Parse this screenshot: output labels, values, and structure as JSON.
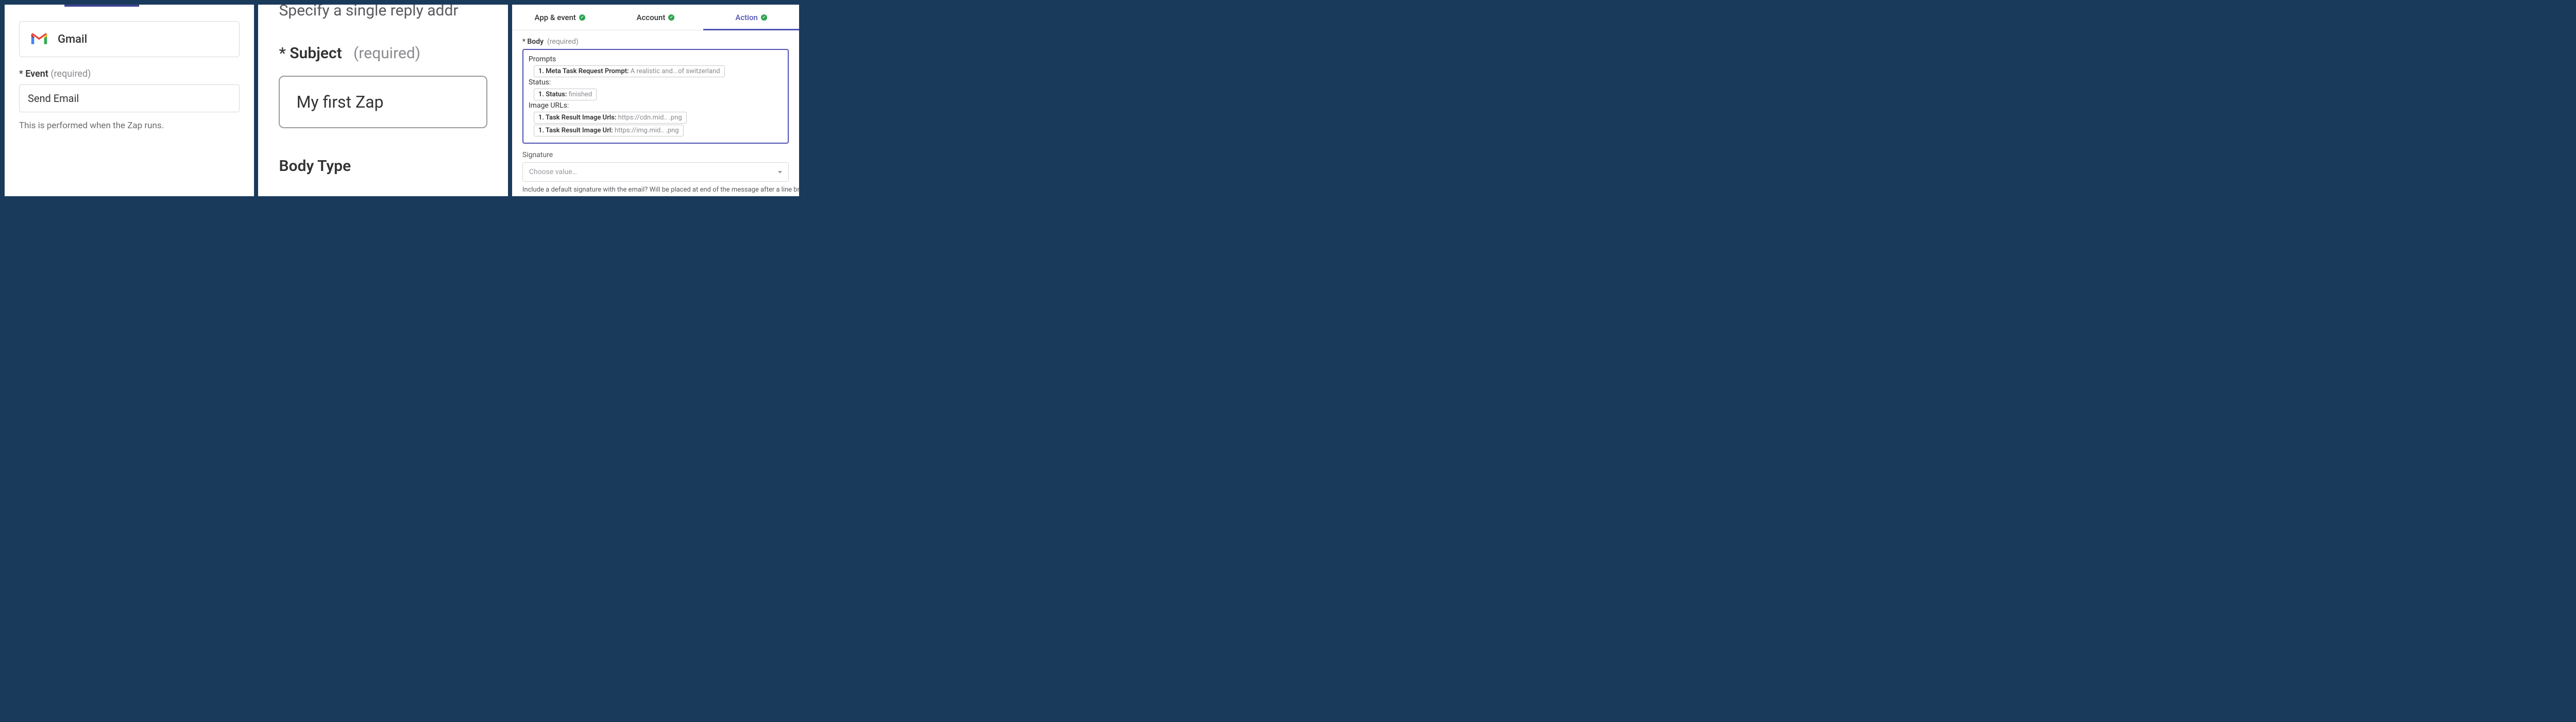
{
  "panel1": {
    "app_name": "Gmail",
    "event_label_star": "*",
    "event_label": "Event",
    "event_hint": "(required)",
    "event_value": "Send Email",
    "helper": "This is performed when the Zap runs."
  },
  "panel2": {
    "top_text": "Specify a single reply addr",
    "subject_star": "*",
    "subject_label": "Subject",
    "subject_hint": "(required)",
    "subject_value": "My first Zap",
    "body_type_label": "Body Type"
  },
  "panel3": {
    "tabs": {
      "app_event": "App & event",
      "account": "Account",
      "action": "Action"
    },
    "body_star": "*",
    "body_label": "Body",
    "body_hint": "(required)",
    "sections": {
      "prompts": "Prompts",
      "status": "Status:",
      "image_urls": "Image URLs:"
    },
    "pills": {
      "prompt_label": "1. Meta Task Request Prompt:",
      "prompt_value": "A realistic and...of switzerland",
      "status_label": "1. Status:",
      "status_value": "finished",
      "urls_label": "1. Task Result Image Urls:",
      "urls_value": "https://cdn.mid..           .png",
      "url_label": "1. Task Result Image Url:",
      "url_value": "https://img.mid..             .png"
    },
    "signature_label": "Signature",
    "signature_placeholder": "Choose value…",
    "signature_help": "Include a default signature with the email? Will be placed at end of the message after a line break an"
  }
}
